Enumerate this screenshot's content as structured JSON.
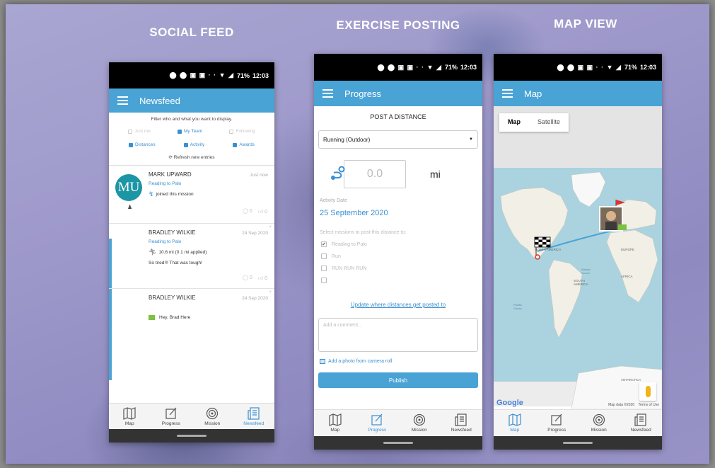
{
  "headings": {
    "social_feed": "SOCIAL FEED",
    "exercise_posting": "EXERCISE POSTING",
    "map_view": "MAP VIEW"
  },
  "status_bar": {
    "battery": "71%",
    "time": "12:03"
  },
  "social_feed": {
    "app_title": "Newsfeed",
    "filter_text": "Filter who and what you want to display.",
    "filters": {
      "just_me": "Just me",
      "my_team": "My Team",
      "following": "Following",
      "distances": "Distances",
      "activity": "Activity",
      "awards": "Awards"
    },
    "refresh_label": "Refresh new entries",
    "posts": [
      {
        "avatar_initials": "MU",
        "name": "MARK UPWARD",
        "date": "Just now",
        "mission": "Reading to Palo",
        "text": "joined this mission",
        "comments": "0",
        "likes": "0"
      },
      {
        "name": "BRADLEY WILKIE",
        "date": "24 Sep 2020",
        "mission": "Reading to Palo",
        "distance": "10.6 mi (0.1 mi applied)",
        "text": "So tired!!! That was tough!",
        "comments": "0",
        "likes": "0"
      },
      {
        "name": "BRADLEY WILKIE",
        "date": "24 Sep 2020",
        "text": "Hey, Brad Here"
      }
    ]
  },
  "exercise_posting": {
    "app_title": "Progress",
    "title": "POST A DISTANCE",
    "activity_select": "Running (Outdoor)",
    "distance_placeholder": "0.0",
    "unit": "mi",
    "activity_date_label": "Activity Date",
    "activity_date": "25 September 2020",
    "missions_label": "Select missions to post this distance to:",
    "missions": [
      {
        "label": "Reading to Palo",
        "checked": true
      },
      {
        "label": "Run",
        "checked": false
      },
      {
        "label": "RUN RUN RUN",
        "checked": false
      },
      {
        "label": "",
        "checked": false
      }
    ],
    "update_link": "Update where distances get posted to",
    "comment_placeholder": "Add a comment...",
    "photo_label": "Add a photo from camera roll",
    "publish_label": "Publish"
  },
  "map_view": {
    "app_title": "Map",
    "map_type_selected": "Map",
    "map_type_other": "Satellite",
    "google_logo": "Google",
    "map_data": "Map data ©2020",
    "terms": "Terms of Use",
    "labels": {
      "north_america": "NORTH AMERICA",
      "south_america": "SOUTH AMERICA",
      "europe": "EUROPE",
      "africa": "AFRICA",
      "antarctica": "ANTARCTICA",
      "atlantic": "Atlantic Ocean",
      "pacific": "Pacific Ocean"
    }
  },
  "tabs": [
    "Map",
    "Progress",
    "Mission",
    "Newsfeed"
  ],
  "colors": {
    "accent": "#4aa3d5",
    "avatar": "#1c95a4",
    "background": "#9c97c9"
  }
}
